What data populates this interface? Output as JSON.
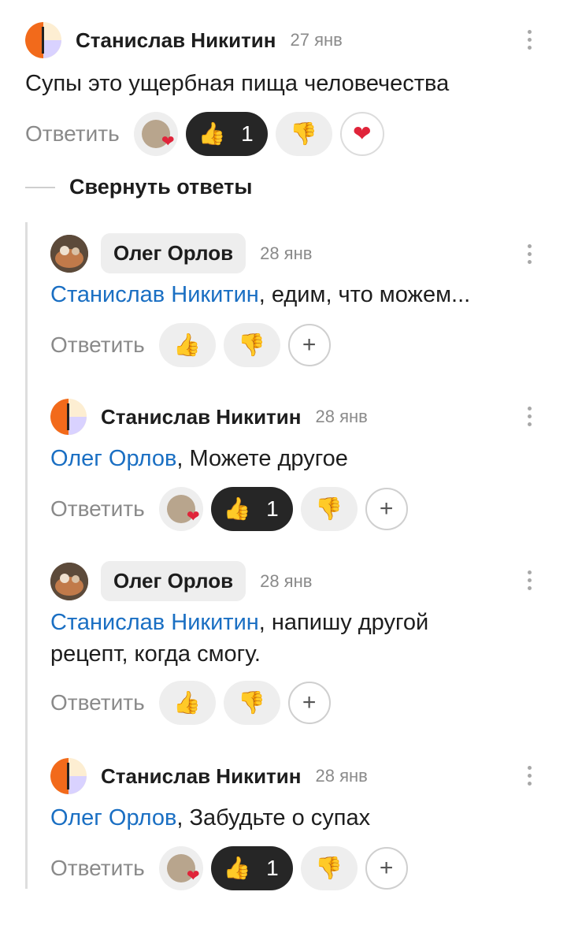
{
  "comments": [
    {
      "author": "Станислав Никитин",
      "date": "27 янв",
      "text": "Супы это ущербная пища человечества",
      "reply_label": "Ответить",
      "likes": "1"
    },
    {
      "author": "Олег Орлов",
      "date": "28 янв",
      "mention": "Станислав Никитин",
      "text": ", едим, что можем...",
      "reply_label": "Ответить"
    },
    {
      "author": "Станислав Никитин",
      "date": "28 янв",
      "mention": "Олег Орлов",
      "text": ", Можете другое",
      "reply_label": "Ответить",
      "likes": "1"
    },
    {
      "author": "Олег Орлов",
      "date": "28 янв",
      "mention": "Станислав Никитин",
      "text": ", напишу другой рецепт, когда смогу.",
      "reply_label": "Ответить"
    },
    {
      "author": "Станислав Никитин",
      "date": "28 янв",
      "mention": "Олег Орлов",
      "text": ", Забудьте о супах",
      "reply_label": "Ответить",
      "likes": "1"
    }
  ],
  "collapse_label": "Свернуть ответы",
  "icons": {
    "like": "thumbs-up-icon",
    "dislike": "thumbs-down-icon",
    "heart": "heart-icon",
    "add_reaction": "plus-icon",
    "more": "more-vertical-icon"
  },
  "colors": {
    "mention": "#1a6fc3",
    "active_chip": "#262626",
    "chip": "#eeeeee"
  }
}
